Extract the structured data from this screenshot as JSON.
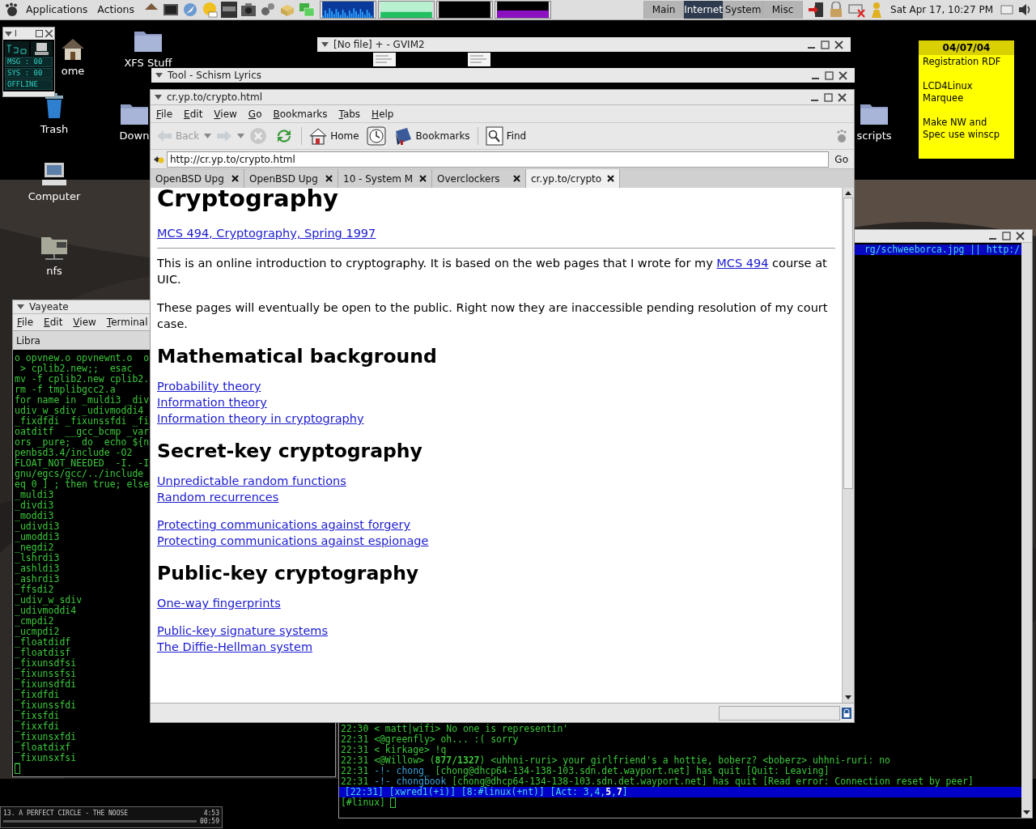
{
  "top_panel": {
    "menus": [
      "Applications",
      "Actions"
    ],
    "workspaces": [
      {
        "label": "Main",
        "selected": false
      },
      {
        "label": "Internet",
        "selected": true
      },
      {
        "label": "System",
        "selected": false
      },
      {
        "label": "Misc",
        "selected": false
      }
    ],
    "clock": "Sat Apr 17, 10:27 PM"
  },
  "desktop_icons": [
    {
      "label": "ome",
      "kind": "home"
    },
    {
      "label": "XFS Stuff",
      "kind": "folder"
    },
    {
      "label": "Trash",
      "kind": "trash"
    },
    {
      "label": "Down",
      "kind": "folder"
    },
    {
      "label": "Computer",
      "kind": "computer"
    },
    {
      "label": "nfs",
      "kind": "nfs"
    },
    {
      "label": "scripts",
      "kind": "folder"
    }
  ],
  "licq_widget": {
    "title": "l",
    "rows": [
      "MSG : 00",
      "SYS : 00",
      "OFFLINE"
    ]
  },
  "gvim_window": {
    "title": "[No file] + - GVIM2"
  },
  "tool_window": {
    "title": "Tool - Schism Lyrics"
  },
  "sticky_note": {
    "date": "04/07/04",
    "paragraphs": [
      [
        "Registration RDF"
      ],
      [
        "LCD4Linux",
        "Marquee"
      ],
      [
        "Make NW and",
        "Spec use winscp"
      ]
    ]
  },
  "browser": {
    "title": "cr.yp.to/crypto.html",
    "menu": [
      "File",
      "Edit",
      "View",
      "Go",
      "Bookmarks",
      "Tabs",
      "Help"
    ],
    "toolbar": [
      {
        "kind": "back",
        "label": "Back",
        "disabled": true
      },
      {
        "kind": "forward",
        "disabled": true
      },
      {
        "kind": "stop",
        "disabled": true
      },
      {
        "kind": "reload",
        "disabled": false
      },
      {
        "kind": "home",
        "label": "Home",
        "disabled": false
      },
      {
        "kind": "history",
        "disabled": false
      },
      {
        "kind": "bookmarks",
        "label": "Bookmarks",
        "disabled": false
      },
      {
        "kind": "find",
        "label": "Find",
        "disabled": false
      }
    ],
    "url": "http://cr.yp.to/crypto.html",
    "go": "Go",
    "tabs": [
      {
        "label": "OpenBSD Upg",
        "selected": false
      },
      {
        "label": "OpenBSD Upg",
        "selected": false
      },
      {
        "label": "10 - System M",
        "selected": false
      },
      {
        "label": "Overclockers",
        "selected": false
      },
      {
        "label": "cr.yp.to/crypto",
        "selected": true
      }
    ],
    "page": {
      "heading": "Cryptography",
      "top_link": "MCS 494, Cryptography, Spring 1997",
      "intro": {
        "before": "This is an online introduction to cryptography. It is based on the web pages that I wrote for my",
        "link": "MCS 494",
        "after": "course at UIC."
      },
      "notice": "These pages will eventually be open to the public. Right now they are inaccessible pending resolution of my court case.",
      "sections": [
        {
          "heading": "Mathematical background",
          "groups": [
            [
              "Probability theory",
              "Information theory",
              "Information theory in cryptography"
            ]
          ]
        },
        {
          "heading": "Secret-key cryptography",
          "groups": [
            [
              "Unpredictable random functions",
              "Random recurrences"
            ],
            [
              "Protecting communications against forgery",
              "Protecting communications against espionage"
            ]
          ]
        },
        {
          "heading": "Public-key cryptography",
          "groups": [
            [
              "One-way fingerprints"
            ],
            [
              "Public-key signature systems",
              "The Diffie-Hellman system"
            ]
          ]
        }
      ]
    }
  },
  "terminal": {
    "title": "Vayeate",
    "menu": [
      "File",
      "Edit",
      "View",
      "Terminal"
    ],
    "tab": "Libra",
    "lines": [
      "o opvnew.o opvnewnt.o  o",
      " > cplib2.new;;  esac",
      "mv -f cplib2.new cplib2.",
      "rm -f tmplibgcc2.a",
      "for name in _muldi3 _div",
      "udiv_w_sdiv _udivmoddi4 ",
      "_fixdfdi _fixunssfdi _fi",
      "oatditf  __gcc_bcmp _var",
      "ors _pure;  do  echo ${n",
      "penbsd3.4/include -O2 ",
      "FLOAT_NOT_NEEDED  -I. -I",
      "gnu/egcs/gcc/../include ",
      "eq 0 ] ; then true; else",
      "_muldi3",
      "_divdi3",
      "_moddi3",
      "_udivdi3",
      "_umoddi3",
      "_negdi2",
      "_lshrdi3",
      "_ashldi3",
      "_ashrdi3",
      "_ffsdi2",
      "_udiv_w_sdiv",
      "_udivmoddi4",
      "_cmpdi2",
      "_ucmpdi2",
      "_floatdidf",
      "_floatdisf",
      "_fixunsdfsi",
      "_fixunssfsi",
      "_fixunsdfdi",
      "_fixdfdi",
      "_fixunssfdi",
      "_fixsfdi",
      "_fixxfdi",
      "_fixunsxfdi",
      "_floatdixf",
      "_fixunsxfsi"
    ]
  },
  "irc": {
    "topic": "rg/schweeborca.jpg || http:/",
    "lines": [
      {
        "kind": "message",
        "time": "22:30",
        "nick": "< matt|wifi>",
        "text": "No one is representin'"
      },
      {
        "kind": "message",
        "time": "22:31",
        "nick": "<@greenfly>",
        "text": "oh... :( sorry"
      },
      {
        "kind": "message",
        "time": "22:31",
        "nick": "< kirkage>",
        "text": "!q"
      },
      {
        "kind": "message",
        "time": "22:31",
        "nick": "<@Willow>",
        "text": "(**877/1327**) <uhhni-ruri> your girlfriend's a hottie, boberz? <boberz> uhhni-ruri: no"
      },
      {
        "kind": "event",
        "time": "22:31",
        "nick": "-!- chong_",
        "text": "[chong@dhcp64-134-138-103.sdn.det.wayport.net] has quit [Quit: Leaving]"
      },
      {
        "kind": "event",
        "time": "22:31",
        "nick": "-!- chongbook",
        "text": "[chong@dhcp64-134-138-103.sdn.det.wayport.net] has quit [Read error: Connection reset by peer]"
      }
    ],
    "status": " [22:31] [xwred1(+i)] [8:#linux(+nt)] [Act: 3,4,**5**,**7**]",
    "prompt": "[#linux]"
  },
  "xmms": {
    "title": "13. A PERFECT CIRCLE - THE NOOSE",
    "total": "4:53",
    "elapsed": "00:59"
  }
}
